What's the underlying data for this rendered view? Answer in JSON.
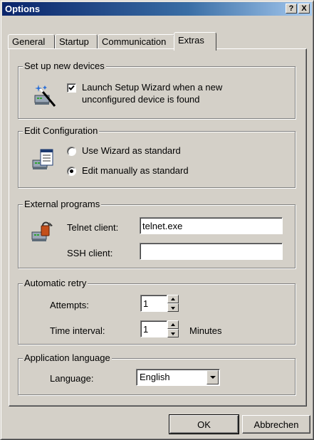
{
  "window": {
    "title": "Options",
    "help_label": "?",
    "close_label": "X"
  },
  "tabs": [
    {
      "label": "General",
      "active": false
    },
    {
      "label": "Startup",
      "active": false
    },
    {
      "label": "Communication",
      "active": false
    },
    {
      "label": "Extras",
      "active": true
    }
  ],
  "setup": {
    "group_label": "Set up new devices",
    "checkbox_checked": true,
    "checkbox_line1": "Launch Setup Wizard when a new",
    "checkbox_line2": "unconfigured device is found",
    "icon": "wizard-wand-icon"
  },
  "edit_config": {
    "group_label": "Edit Configuration",
    "icon": "configuration-form-icon",
    "options": [
      {
        "label": "Use Wizard as standard",
        "selected": false
      },
      {
        "label": "Edit manually as standard",
        "selected": true
      }
    ]
  },
  "external": {
    "group_label": "External programs",
    "icon": "device-program-icon",
    "telnet_label": "Telnet client:",
    "telnet_value": "telnet.exe",
    "ssh_label": "SSH client:",
    "ssh_value": ""
  },
  "retry": {
    "group_label": "Automatic retry",
    "attempts_label": "Attempts:",
    "attempts_value": "1",
    "interval_label": "Time interval:",
    "interval_value": "1",
    "interval_unit": "Minutes"
  },
  "language": {
    "group_label": "Application language",
    "label": "Language:",
    "value": "English"
  },
  "buttons": {
    "ok": "OK",
    "cancel": "Abbrechen"
  },
  "colors": {
    "face": "#d4d0c8",
    "titlebar_start": "#0a246a",
    "titlebar_end": "#a6caf0"
  }
}
